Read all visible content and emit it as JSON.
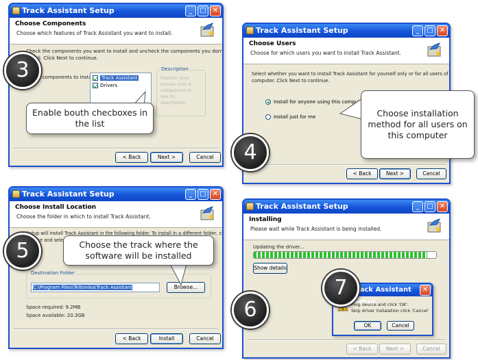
{
  "common": {
    "window_title": "Track Assistant Setup",
    "back": "< Back",
    "next": "Next >",
    "cancel": "Cancel",
    "install": "Install",
    "ok": "OK"
  },
  "step3": {
    "number": "3",
    "header_title": "Choose Components",
    "header_sub": "Choose which features of Track Assistant you want to install.",
    "body_text_1": "Check the components you want to install and uncheck the components you don't want to",
    "body_text_2": "install. Click Next to continue.",
    "select_label": "Select components to install:",
    "components": [
      "Track Assistant",
      "Drivers"
    ],
    "description_title": "Description",
    "description_text": "Position your mouse over a component to see its description.",
    "callout": "Enable bouth checboxes in the list"
  },
  "step4": {
    "number": "4",
    "header_title": "Choose Users",
    "header_sub": "Choose for which users you want to install Track Assistant.",
    "body_text_1": "Select whether you want to install Track Assistant for yourself only or for all users of this",
    "body_text_2": "computer. Click Next to continue.",
    "option_all": "Install for anyone using this computer",
    "option_me": "Install just for me",
    "callout": "Choose installation method for all users on this computer"
  },
  "step5": {
    "number": "5",
    "header_title": "Choose Install Location",
    "header_sub": "Choose the folder in which to install Track Assistant.",
    "body_text_1": "Setup will install Track Assistant in the following folder. To install in a different folder, click",
    "body_text_2": "Browse and select another folder. Click Install to start the installation.",
    "dest_label": "Destination Folder",
    "dest_path": "C:\\Program Files\\Teltonika\\Track Assistant",
    "browse": "Browse...",
    "space_required": "Space required: 9.2MB",
    "space_available": "Space available: 20.3GB",
    "callout": "Choose the track where the software will be installed"
  },
  "step6": {
    "number": "6",
    "header_title": "Installing",
    "header_sub": "Please wait while Track Assistant is being installed.",
    "status": "Updating the driver...",
    "progress": 0.95,
    "show_details": "Show details"
  },
  "step7": {
    "number": "7",
    "dialog_title": "Track Assistant Setup",
    "dialog_line1": "Plug device and click 'OK'.",
    "dialog_line2": "Skip driver instalation click 'Cancel'"
  }
}
